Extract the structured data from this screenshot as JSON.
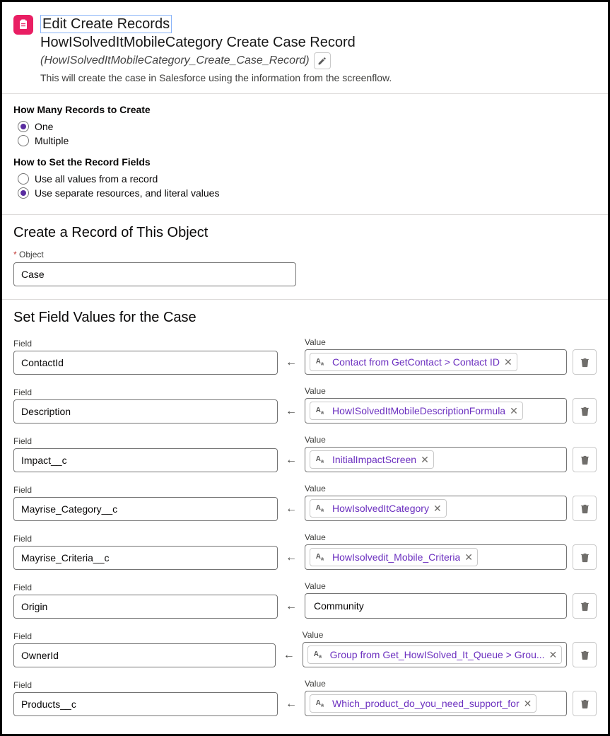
{
  "header": {
    "title": "Edit Create Records",
    "subtitle": "HowISolvedItMobileCategory Create Case Record",
    "apiName": "(HowISolvedItMobileCategory_Create_Case_Record)",
    "description": "This will create the case in Salesforce using the information from the screenflow."
  },
  "howMany": {
    "question": "How Many Records to Create",
    "options": [
      "One",
      "Multiple"
    ],
    "selected": "One"
  },
  "howSet": {
    "question": "How to Set the Record Fields",
    "options": [
      "Use all values from a record",
      "Use separate resources, and literal values"
    ],
    "selected": "Use separate resources, and literal values"
  },
  "createRecord": {
    "heading": "Create a Record of This Object",
    "objectLabel": "Object",
    "objectValue": "Case"
  },
  "setFields": {
    "heading": "Set Field Values for the Case",
    "fieldLabel": "Field",
    "valueLabel": "Value",
    "arrow": "←",
    "rows": [
      {
        "field": "ContactId",
        "valueType": "pill",
        "value": "Contact from GetContact > Contact ID"
      },
      {
        "field": "Description",
        "valueType": "pill",
        "value": "HowISolvedItMobileDescriptionFormula"
      },
      {
        "field": "Impact__c",
        "valueType": "pill",
        "value": "InitialImpactScreen"
      },
      {
        "field": "Mayrise_Category__c",
        "valueType": "pill",
        "value": "HowIsolvedItCategory"
      },
      {
        "field": "Mayrise_Criteria__c",
        "valueType": "pill",
        "value": "HowIsolvedit_Mobile_Criteria"
      },
      {
        "field": "Origin",
        "valueType": "plain",
        "value": "Community"
      },
      {
        "field": "OwnerId",
        "valueType": "pill",
        "value": "Group from Get_HowISolved_It_Queue > Grou..."
      },
      {
        "field": "Products__c",
        "valueType": "pill",
        "value": "Which_product_do_you_need_support_for"
      }
    ]
  }
}
